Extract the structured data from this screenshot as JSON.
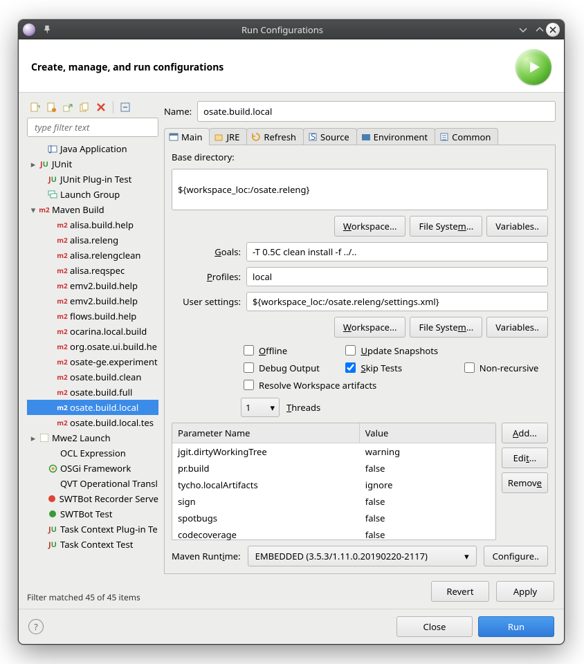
{
  "window": {
    "title": "Run Configurations"
  },
  "header": {
    "title": "Create, manage, and run configurations"
  },
  "filter": {
    "placeholder": "type filter text"
  },
  "tree": {
    "java_app": "Java Application",
    "junit": "JUnit",
    "junit_plugin": "JUnit Plug-in Test",
    "launch_group": "Launch Group",
    "maven_build": "Maven Build",
    "maven_children": [
      "alisa.build.help",
      "alisa.releng",
      "alisa.relengclean",
      "alisa.reqspec",
      "emv2.build.help",
      "emv2.build.help",
      "flows.build.help",
      "ocarina.local.build",
      "org.osate.ui.build.he",
      "osate-ge.experiment",
      "osate.build.clean",
      "osate.build.full",
      "osate.build.local",
      "osate.build.local.tes"
    ],
    "selected_index": 12,
    "mwe2": "Mwe2 Launch",
    "ocl": "OCL Expression",
    "osgi": "OSGi Framework",
    "qvt": "QVT Operational Transl",
    "swt_rec": "SWTBot Recorder Serve",
    "swt_test": "SWTBot Test",
    "task_plugin": "Task Context Plug-in Te",
    "task_test": "Task Context Test"
  },
  "filter_status": "Filter matched 45 of 45 items",
  "name": {
    "label": "Name:",
    "value": "osate.build.local"
  },
  "tabs": [
    "Main",
    "JRE",
    "Refresh",
    "Source",
    "Environment",
    "Common"
  ],
  "main": {
    "basedir_label": "Base directory:",
    "basedir": "${workspace_loc:/osate.releng}",
    "goals_label": "Goals:",
    "goals": "-T 0.5C clean install -f ../..",
    "profiles_label": "Profiles:",
    "profiles": "local",
    "usersettings_label": "User settings:",
    "usersettings": "${workspace_loc:/osate.releng/settings.xml}",
    "btn_workspace": "Workspace...",
    "btn_filesystem": "File System...",
    "btn_variables": "Variables..",
    "chk_offline": "Offline",
    "chk_update": "Update Snapshots",
    "chk_debug": "Debug Output",
    "chk_skip": "Skip Tests",
    "chk_nonrec": "Non-recursive",
    "chk_resolve": "Resolve Workspace artifacts",
    "threads_value": "1",
    "threads_label": "Threads",
    "param_name_hdr": "Parameter Name",
    "param_value_hdr": "Value",
    "params": [
      {
        "n": "jgit.dirtyWorkingTree",
        "v": "warning"
      },
      {
        "n": "pr.build",
        "v": "false"
      },
      {
        "n": "tycho.localArtifacts",
        "v": "ignore"
      },
      {
        "n": "sign",
        "v": "false"
      },
      {
        "n": "spotbugs",
        "v": "false"
      },
      {
        "n": "codecoverage",
        "v": "false"
      }
    ],
    "btn_add": "Add...",
    "btn_edit": "Edit...",
    "btn_remove": "Remove",
    "runtime_label": "Maven Runtime:",
    "runtime_value": "EMBEDDED (3.5.3/1.11.0.20190220-2117)",
    "btn_configure": "Configure.."
  },
  "actions": {
    "revert": "Revert",
    "apply": "Apply"
  },
  "footer": {
    "close": "Close",
    "run": "Run"
  }
}
